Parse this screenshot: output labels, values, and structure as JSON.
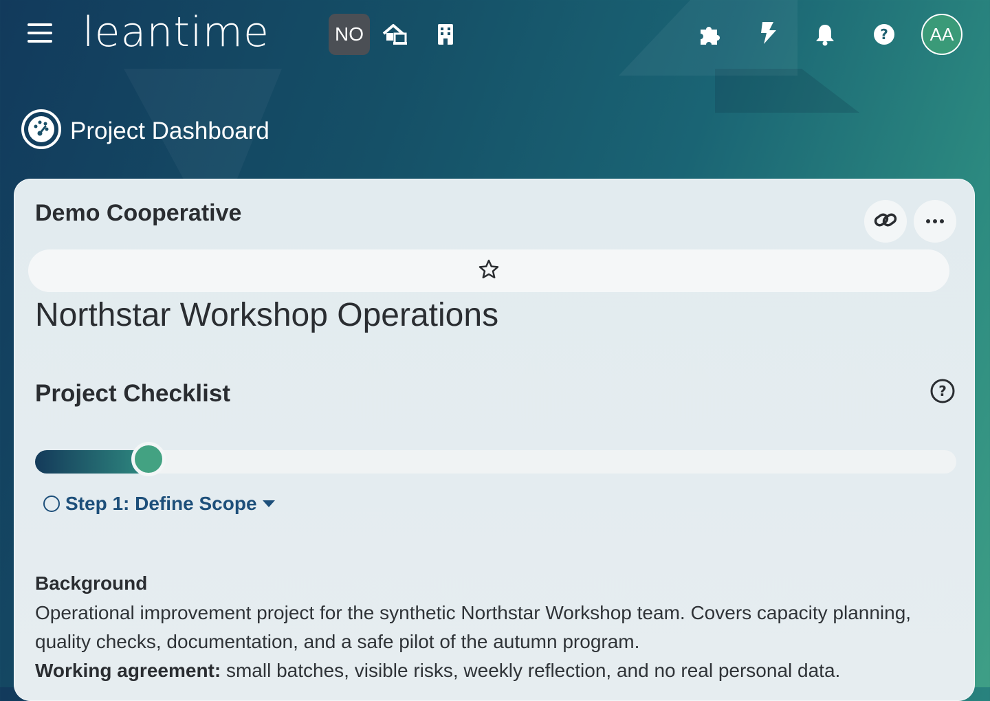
{
  "header": {
    "logo": "leantime",
    "project_badge": "NO",
    "icons": [
      "menu-icon",
      "home-office-icon",
      "building-icon",
      "puzzle-icon",
      "lightning-icon",
      "bell-icon",
      "help-icon"
    ],
    "avatar_initials": "AA"
  },
  "page": {
    "title": "Project Dashboard",
    "title_icon": "dashboard-gauge-icon"
  },
  "card": {
    "client_name": "Demo Cooperative",
    "project_name": "Northstar Workshop Operations",
    "checklist": {
      "title": "Project Checklist",
      "progress_percent": 12.3,
      "current_step": "Step 1: Define Scope"
    },
    "background": {
      "heading": "Background",
      "description": "Operational improvement project for the synthetic Northstar Workshop team. Covers capacity planning, quality checks, documentation, and a safe pilot of the autumn program.",
      "agreement_label": "Working agreement:",
      "agreement_text": " small batches, visible risks, weekly reflection, and no real personal data."
    }
  },
  "colors": {
    "accent": "#43a282",
    "progress_start": "#143a5a",
    "step_text": "#1d4f7a"
  }
}
